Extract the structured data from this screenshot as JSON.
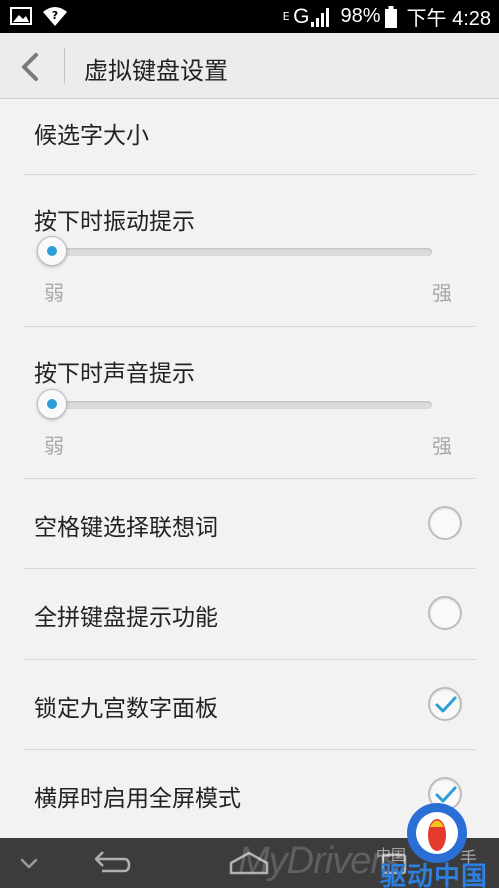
{
  "status_bar": {
    "network_sub": "E",
    "network_type": "G",
    "battery": "98%",
    "time": "下午 4:28",
    "icons": [
      "image-icon",
      "wifi-question-icon",
      "signal-icon",
      "battery-icon"
    ]
  },
  "action_bar": {
    "title": "虚拟键盘设置",
    "back_icon": "chevron-left-icon"
  },
  "settings": {
    "candidate_size": {
      "label": "候选字大小"
    },
    "vibration": {
      "label": "按下时振动提示",
      "min_label": "弱",
      "max_label": "强",
      "value": 0
    },
    "sound": {
      "label": "按下时声音提示",
      "min_label": "弱",
      "max_label": "强",
      "value": 0
    },
    "space_assoc": {
      "label": "空格键选择联想词",
      "checked": false
    },
    "pinyin_hint": {
      "label": "全拼键盘提示功能",
      "checked": false
    },
    "lock_nine": {
      "label": "锁定九宫数字面板",
      "checked": true
    },
    "landscape_full": {
      "label": "横屏时启用全屏模式",
      "checked": true
    }
  },
  "nav_bar": {
    "buttons": [
      "hide-keyboard-icon",
      "back-arrow-icon",
      "home-icon",
      "recents-icon"
    ]
  },
  "watermark": {
    "text": "MyDrivers",
    "brand_cn": "驱动中国",
    "small": "中国",
    "hand": "手"
  },
  "colors": {
    "accent": "#2d9ed8",
    "status_bar": "#000000",
    "background": "#f2f2f2",
    "nav_bar": "#3c3c3c"
  }
}
